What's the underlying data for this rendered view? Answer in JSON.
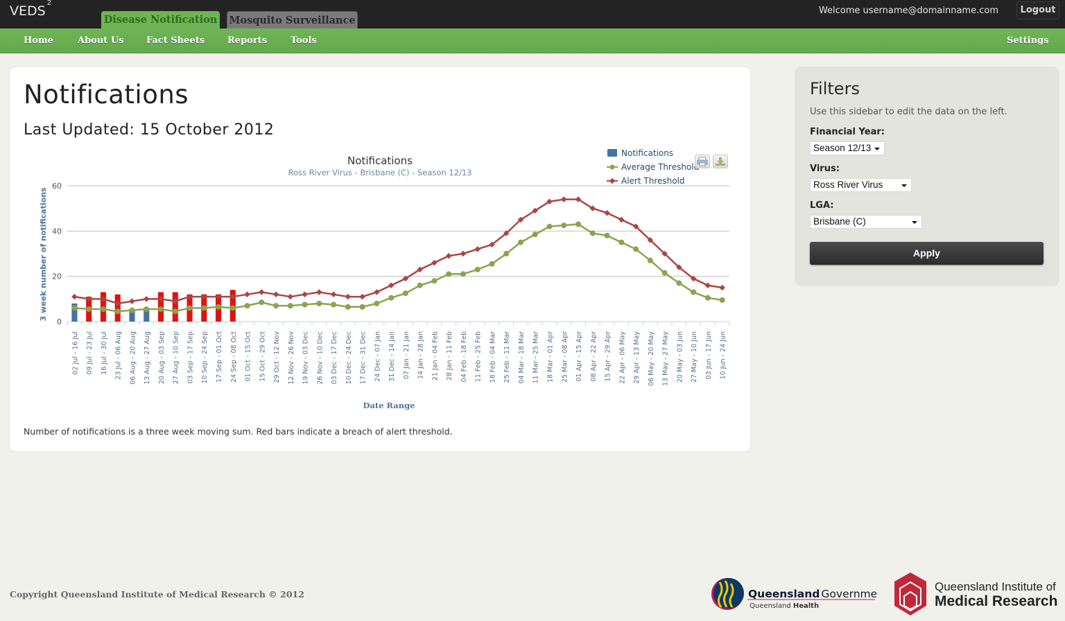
{
  "header": {
    "logo": "VEDS",
    "logo_superscript": "2",
    "tabs": [
      {
        "label": "Disease Notification",
        "active": true
      },
      {
        "label": "Mosquito Surveillance",
        "active": false
      }
    ],
    "welcome": "Welcome username@domainname.com",
    "logout_label": "Logout"
  },
  "nav": {
    "items": [
      "Home",
      "About Us",
      "Fact Sheets",
      "Reports",
      "Tools"
    ],
    "settings_label": "Settings"
  },
  "main": {
    "title": "Notifications",
    "last_updated": "Last Updated: 15 October 2012",
    "footnote": "Number of notifications is a three week moving sum. Red bars indicate a breach of alert threshold.",
    "print_icon": "printer-icon",
    "download_icon": "download-icon"
  },
  "colors": {
    "notifications": "#4572a7",
    "breach": "#e0120f",
    "average": "#89a54e",
    "alert": "#aa4643",
    "nav_green": "#6ab150"
  },
  "chart_data": {
    "type": "bar",
    "title": "Notifications",
    "subtitle": "Ross River Virus - Brisbane (C) - Season 12/13",
    "xlabel": "Date Range",
    "ylabel": "3 week number of notifications",
    "ylim": [
      0,
      60
    ],
    "yticks": [
      0,
      20,
      40,
      60
    ],
    "grid": true,
    "legend_position": "top-right",
    "legend": [
      "Notifications",
      "Average Threshold",
      "Alert Threshold"
    ],
    "categories": [
      "02 Jul - 16 Jul",
      "09 Jul - 23 Jul",
      "16 Jul - 30 Jul",
      "23 Jul - 06 Aug",
      "06 Aug - 20 Aug",
      "13 Aug - 27 Aug",
      "20 Aug - 03 Sep",
      "27 Aug - 10 Sep",
      "03 Sep - 17 Sep",
      "10 Sep - 24 Sep",
      "17 Sep - 01 Oct",
      "24 Sep - 08 Oct",
      "01 Oct - 15 Oct",
      "15 Oct - 29 Oct",
      "29 Oct - 12 Nov",
      "12 Nov - 26 Nov",
      "19 Nov - 03 Dec",
      "26 Nov - 10 Dec",
      "03 Dec - 17 Dec",
      "10 Dec - 24 Dec",
      "17 Dec - 31 Dec",
      "24 Dec - 07 Jan",
      "31 Dec - 14 Jan",
      "07 Jan - 21 Jan",
      "14 Jan - 28 Jan",
      "21 Jan - 04 Feb",
      "28 Jan - 11 Feb",
      "04 Feb - 18 Feb",
      "11 Feb - 25 Feb",
      "18 Feb - 04 Mar",
      "25 Feb - 11 Mar",
      "04 Mar - 18 Mar",
      "11 Mar - 25 Mar",
      "18 Mar - 01 Apr",
      "25 Mar - 08 Apr",
      "01 Apr - 15 Apr",
      "08 Apr - 22 Apr",
      "15 Apr - 29 Apr",
      "22 Apr - 06 May",
      "29 Apr - 13 May",
      "06 May - 20 May",
      "13 May - 27 May",
      "20 May - 03 Jun",
      "27 May - 10 Jun",
      "03 Jun - 17 Jun",
      "10 Jun - 24 Jun"
    ],
    "series": [
      {
        "name": "Notifications",
        "type": "bar",
        "values": [
          8,
          11,
          13,
          12,
          5,
          6,
          13,
          13,
          12,
          12,
          12,
          14,
          0,
          0,
          0,
          0,
          0,
          0,
          0,
          0,
          0,
          0,
          0,
          0,
          0,
          0,
          0,
          0,
          0,
          0,
          0,
          0,
          0,
          0,
          0,
          0,
          0,
          0,
          0,
          0,
          0,
          0,
          0,
          0,
          0,
          0
        ],
        "breach": [
          false,
          true,
          true,
          true,
          false,
          false,
          true,
          true,
          true,
          true,
          true,
          true,
          false,
          false,
          false,
          false,
          false,
          false,
          false,
          false,
          false,
          false,
          false,
          false,
          false,
          false,
          false,
          false,
          false,
          false,
          false,
          false,
          false,
          false,
          false,
          false,
          false,
          false,
          false,
          false,
          false,
          false,
          false,
          false,
          false,
          false
        ]
      },
      {
        "name": "Average Threshold",
        "type": "line",
        "values": [
          6,
          5.5,
          5.5,
          4.5,
          5,
          5.5,
          5.5,
          4.5,
          6,
          6,
          6.5,
          6,
          7,
          8.5,
          7,
          7,
          7.5,
          8,
          7.5,
          6.5,
          6.5,
          8,
          10.5,
          12.5,
          16,
          18,
          21,
          21,
          23,
          25.5,
          30,
          35,
          38.5,
          42,
          42.5,
          43,
          39,
          38,
          35,
          32,
          27,
          21.5,
          17,
          13,
          10.5,
          9.5
        ]
      },
      {
        "name": "Alert Threshold",
        "type": "line",
        "values": [
          11,
          10,
          10,
          8,
          9,
          10,
          10,
          9,
          11,
          11,
          11,
          11,
          12,
          13,
          12,
          11,
          12,
          13,
          12,
          11,
          11,
          13,
          16,
          19,
          23,
          26,
          29,
          30,
          32,
          34,
          39,
          45,
          49,
          53,
          54,
          54,
          50,
          48,
          45,
          42,
          36,
          30,
          24,
          19,
          16,
          15
        ]
      }
    ]
  },
  "sidebar": {
    "title": "Filters",
    "description": "Use this sidebar to edit the data on the left.",
    "fields": [
      {
        "label": "Financial Year:",
        "value": "Season 12/13"
      },
      {
        "label": "Virus:",
        "value": "Ross River Virus"
      },
      {
        "label": "LGA:",
        "value": "Brisbane (C)"
      }
    ],
    "apply_label": "Apply"
  },
  "footer": {
    "copyright": "Copyright Queensland Institute of Medical Research © 2012",
    "qg_name_bold": "Queensland",
    "qg_name_rest": "Government",
    "qg_sub_plain": "Queensland ",
    "qg_sub_bold": "Health",
    "qimr_line1": "Queensland Institute of",
    "qimr_line2": "Medical Research"
  }
}
